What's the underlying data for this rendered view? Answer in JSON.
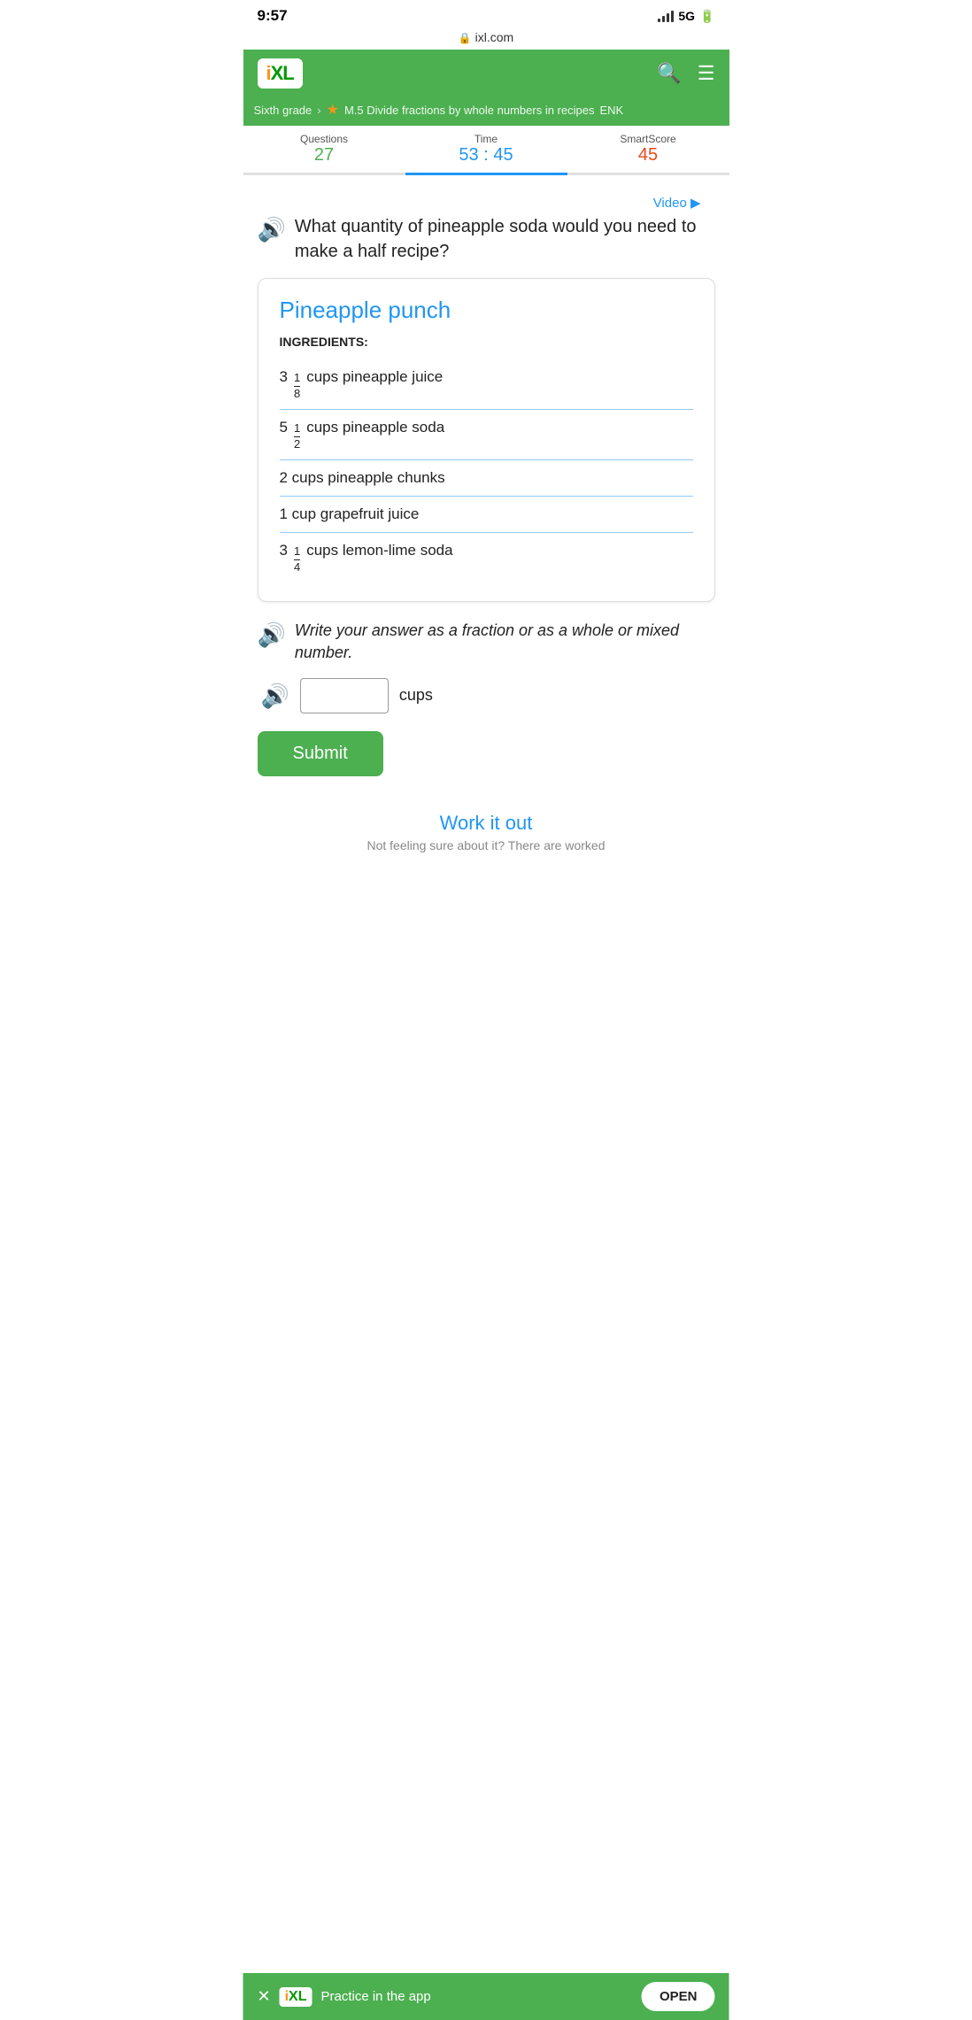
{
  "statusBar": {
    "time": "9:57",
    "signal": "5G",
    "url": "ixl.com"
  },
  "header": {
    "logoText": "IXL",
    "searchLabel": "search",
    "menuLabel": "menu"
  },
  "breadcrumb": {
    "grade": "Sixth grade",
    "lesson": "M.5 Divide fractions by whole numbers in recipes",
    "code": "ENK"
  },
  "stats": {
    "questionsLabel": "Questions",
    "questionsValue": "27",
    "timeLabel": "Time",
    "timeValue": "53 : 45",
    "smartScoreLabel": "SmartScore",
    "smartScoreValue": "45"
  },
  "videoLink": "Video ▶",
  "question": "What quantity of pineapple soda would you need to make a half recipe?",
  "recipe": {
    "title": "Pineapple punch",
    "ingredientsLabel": "INGREDIENTS:",
    "ingredients": [
      {
        "whole": "3",
        "num": "1",
        "den": "8",
        "text": "cups pineapple juice"
      },
      {
        "whole": "5",
        "num": "1",
        "den": "2",
        "text": "cups pineapple soda"
      },
      {
        "whole": "2",
        "num": "",
        "den": "",
        "text": "cups pineapple chunks"
      },
      {
        "whole": "1",
        "num": "",
        "den": "",
        "text": "cup grapefruit juice"
      },
      {
        "whole": "3",
        "num": "1",
        "den": "4",
        "text": "cups lemon-lime soda"
      }
    ]
  },
  "instruction": "Write your answer as a fraction or as a whole or mixed number.",
  "inputPlaceholder": "",
  "cupsLabel": "cups",
  "submitLabel": "Submit",
  "workItOut": "Work it out",
  "workItOutSub": "Not feeling sure about it? There are worked",
  "bottomBar": {
    "appText": "Practice in the app",
    "openLabel": "OPEN"
  }
}
